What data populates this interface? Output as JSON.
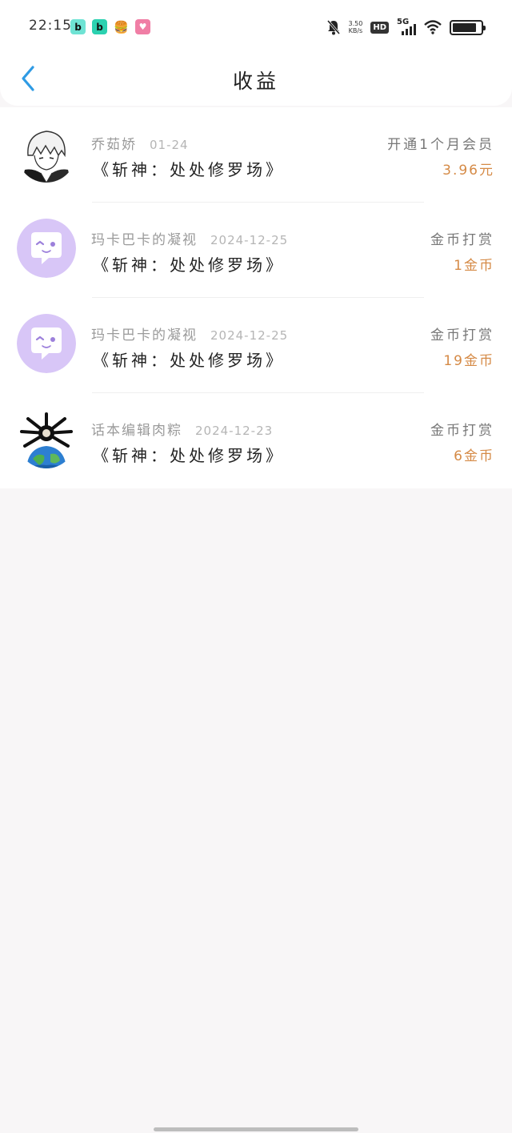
{
  "status_bar": {
    "time": "22:15",
    "net_speed_value": "3.50",
    "net_speed_unit": "KB/s",
    "hd_badge": "HD",
    "network": "5G",
    "apps": [
      {
        "icon": "bilibili-app-icon",
        "glyph": "b",
        "color": "#6fe3d4"
      },
      {
        "icon": "bilibili-app-icon",
        "glyph": "b",
        "color": "#2bd1b0"
      },
      {
        "icon": "burger-app-icon",
        "glyph": "🍔",
        "color": "#ffffff"
      },
      {
        "icon": "pink-app-icon",
        "glyph": "♥",
        "color": "#f07ea5"
      }
    ],
    "battery_level": 0.85
  },
  "header": {
    "title": "收益",
    "back_icon": "chevron-left-icon",
    "accent_color": "#2f9be4"
  },
  "records": [
    {
      "name": "乔茹娇",
      "date": "01-24",
      "book": "《斩神：处处修罗场》",
      "type": "开通1个月会员",
      "amount": "3.96元",
      "avatar_icon": "anime-avatar"
    },
    {
      "name": "玛卡巴卡的凝视",
      "date": "2024-12-25",
      "book": "《斩神：处处修罗场》",
      "type": "金币打赏",
      "amount": "1金币",
      "avatar_icon": "chat-bubble-avatar"
    },
    {
      "name": "玛卡巴卡的凝视",
      "date": "2024-12-25",
      "book": "《斩神：处处修罗场》",
      "type": "金币打赏",
      "amount": "19金币",
      "avatar_icon": "chat-bubble-avatar"
    },
    {
      "name": "话本编辑肉粽",
      "date": "2024-12-23",
      "book": "《斩神：处处修罗场》",
      "type": "金币打赏",
      "amount": "6金币",
      "avatar_icon": "earth-avatar"
    }
  ],
  "colors": {
    "amount": "#d58a46",
    "avatar_bubble_bg": "#d8c6f7"
  }
}
